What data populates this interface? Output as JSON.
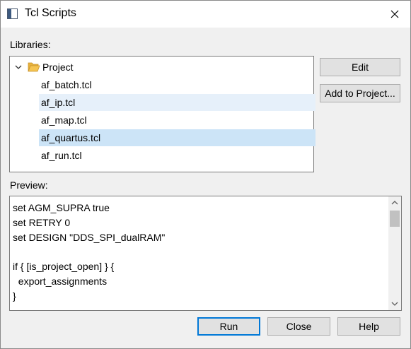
{
  "window": {
    "title": "Tcl Scripts",
    "close_glyph": "✕"
  },
  "libraries": {
    "label": "Libraries:",
    "root": {
      "label": "Project",
      "expanded": true,
      "icon": "folder-open-icon"
    },
    "files": [
      {
        "label": "af_batch.tcl",
        "state": "normal"
      },
      {
        "label": "af_ip.tcl",
        "state": "hover"
      },
      {
        "label": "af_map.tcl",
        "state": "normal"
      },
      {
        "label": "af_quartus.tcl",
        "state": "selected"
      },
      {
        "label": "af_run.tcl",
        "state": "normal"
      }
    ]
  },
  "side_buttons": {
    "edit": "Edit",
    "add_to_project": "Add to Project..."
  },
  "preview": {
    "label": "Preview:",
    "code": "set AGM_SUPRA true\nset RETRY 0\nset DESIGN \"DDS_SPI_dualRAM\"\n\nif { [is_project_open] } {\n  export_assignments\n}"
  },
  "footer": {
    "run": "Run",
    "close": "Close",
    "help": "Help"
  },
  "colors": {
    "selection": "#cce4f7",
    "hover": "#e6f0fa",
    "button_face": "#e1e1e1",
    "default_border": "#0078d7",
    "folder": "#f5c451"
  }
}
